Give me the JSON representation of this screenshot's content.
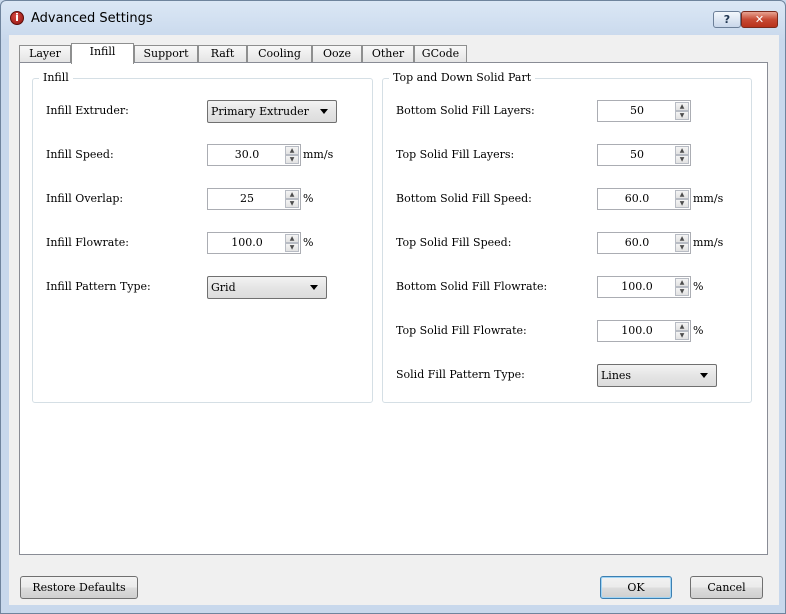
{
  "window": {
    "title": "Advanced Settings",
    "help_label": "?",
    "close_label": "✕",
    "app_icon_glyph": "i"
  },
  "tabs": [
    {
      "label": "Layer",
      "active": false
    },
    {
      "label": "Infill",
      "active": true
    },
    {
      "label": "Support",
      "active": false
    },
    {
      "label": "Raft",
      "active": false
    },
    {
      "label": "Cooling",
      "active": false
    },
    {
      "label": "Ooze",
      "active": false
    },
    {
      "label": "Other",
      "active": false
    },
    {
      "label": "GCode",
      "active": false
    }
  ],
  "infill_group": {
    "title": "Infill",
    "extruder": {
      "label": "Infill Extruder:",
      "value": "Primary Extruder"
    },
    "speed": {
      "label": "Infill Speed:",
      "value": "30.0",
      "unit": "mm/s"
    },
    "overlap": {
      "label": "Infill Overlap:",
      "value": "25",
      "unit": "%"
    },
    "flowrate": {
      "label": "Infill Flowrate:",
      "value": "100.0",
      "unit": "%"
    },
    "pattern": {
      "label": "Infill Pattern Type:",
      "value": "Grid"
    }
  },
  "solid_group": {
    "title": "Top and Down Solid Part",
    "bottom_layers": {
      "label": "Bottom Solid Fill Layers:",
      "value": "50"
    },
    "top_layers": {
      "label": "Top Solid Fill Layers:",
      "value": "50"
    },
    "bottom_speed": {
      "label": "Bottom Solid Fill Speed:",
      "value": "60.0",
      "unit": "mm/s"
    },
    "top_speed": {
      "label": "Top Solid Fill Speed:",
      "value": "60.0",
      "unit": "mm/s"
    },
    "bottom_flowrate": {
      "label": "Bottom Solid Fill Flowrate:",
      "value": "100.0",
      "unit": "%"
    },
    "top_flowrate": {
      "label": "Top Solid Fill Flowrate:",
      "value": "100.0",
      "unit": "%"
    },
    "pattern": {
      "label": "Solid Fill Pattern Type:",
      "value": "Lines"
    }
  },
  "footer": {
    "restore_label": "Restore Defaults",
    "ok_label": "OK",
    "cancel_label": "Cancel"
  },
  "spin_arrows": {
    "up": "▲",
    "down": "▼"
  }
}
